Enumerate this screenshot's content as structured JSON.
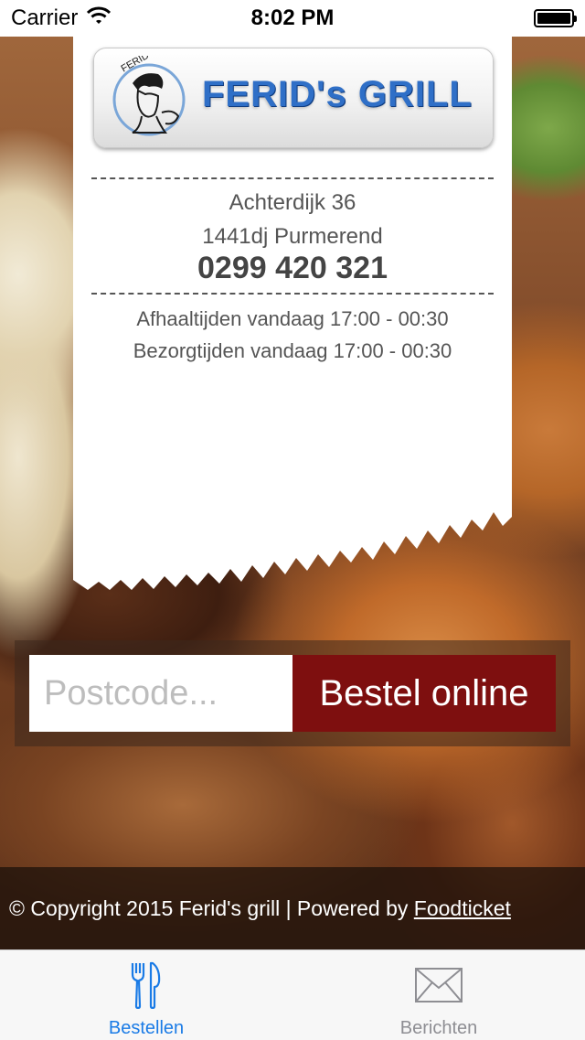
{
  "status_bar": {
    "carrier": "Carrier",
    "time": "8:02 PM"
  },
  "logo": {
    "text": "FERID's GRILL"
  },
  "address": {
    "street": "Achterdijk 36",
    "city": "1441dj Purmerend",
    "phone": "0299 420 321"
  },
  "hours": {
    "pickup": "Afhaaltijden vandaag 17:00 - 00:30",
    "delivery": "Bezorgtijden vandaag 17:00 - 00:30"
  },
  "order": {
    "postcode_placeholder": "Postcode...",
    "postcode_value": "",
    "button_label": "Bestel online"
  },
  "footer": {
    "copyright": "© Copyright 2015 Ferid's grill | Powered by ",
    "link": "Foodticket"
  },
  "tabs": [
    {
      "label": "Bestellen",
      "icon": "fork-knife-icon",
      "active": true
    },
    {
      "label": "Berichten",
      "icon": "envelope-icon",
      "active": false
    }
  ],
  "colors": {
    "accent": "#1a7be6",
    "order_button": "#7e0f0f",
    "logo_text": "#2f6fc7"
  }
}
